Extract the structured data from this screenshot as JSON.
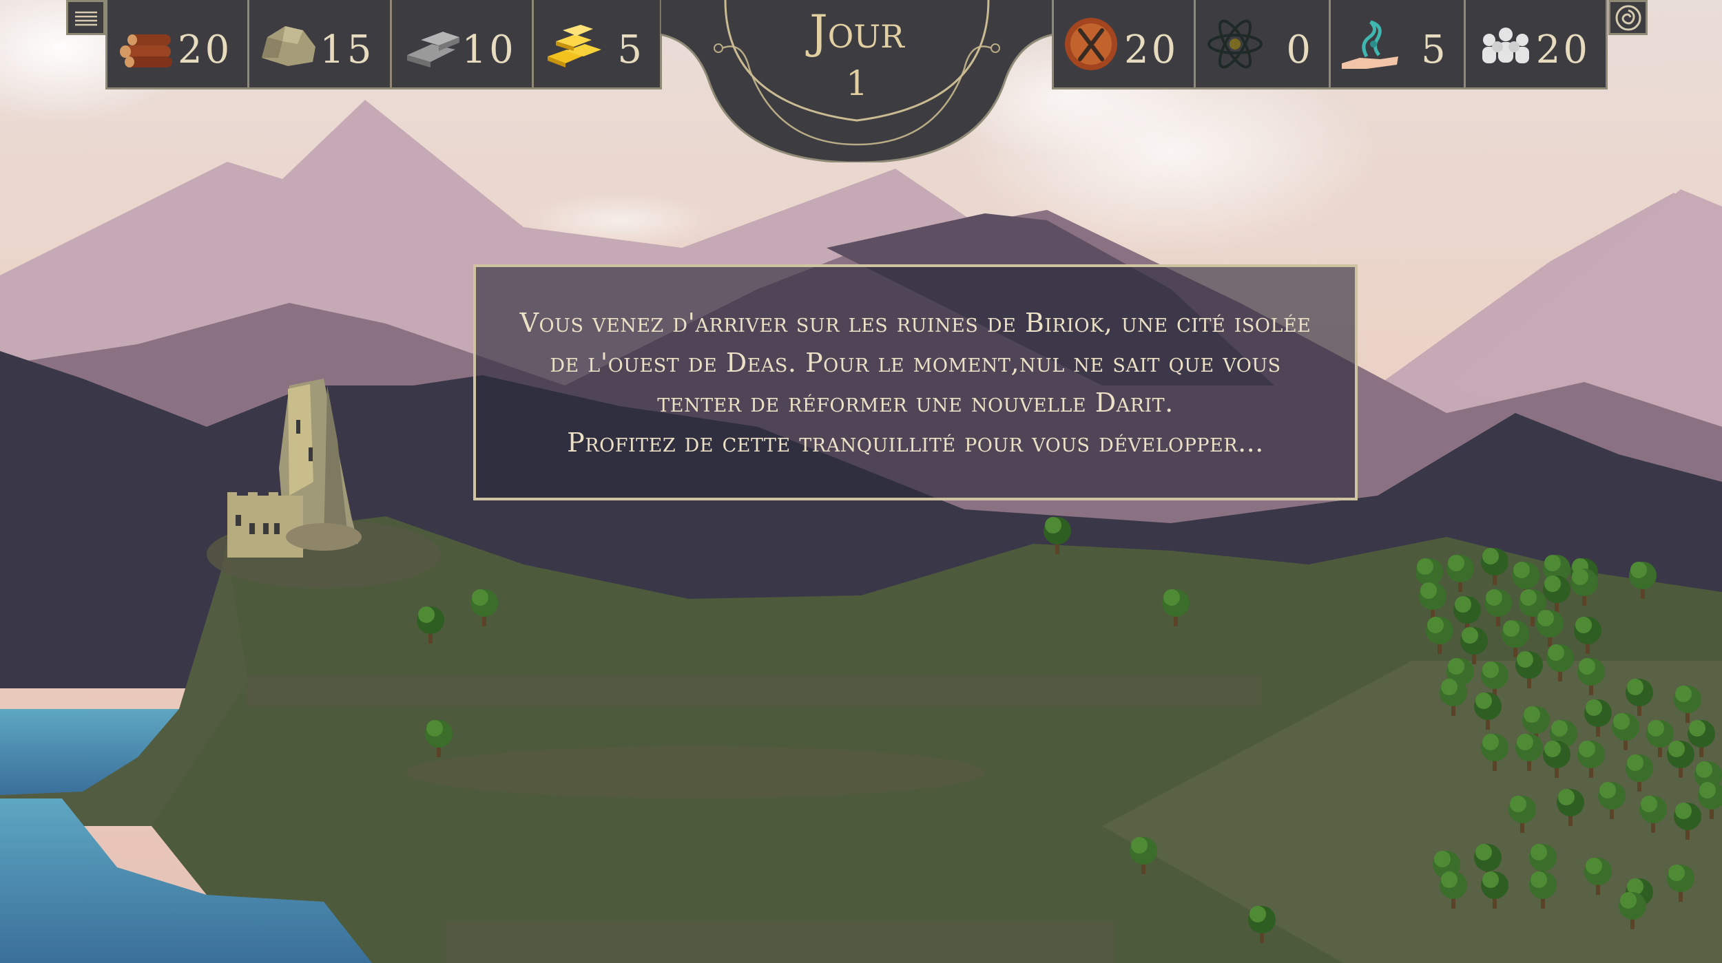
{
  "hud": {
    "resources_left": [
      {
        "name": "wood",
        "icon": "log-pile-icon",
        "value": "20"
      },
      {
        "name": "stone",
        "icon": "rock-icon",
        "value": "15"
      },
      {
        "name": "iron",
        "icon": "iron-ingot-icon",
        "value": "10"
      },
      {
        "name": "gold",
        "icon": "gold-bars-icon",
        "value": "5"
      }
    ],
    "resources_right": [
      {
        "name": "food",
        "icon": "fork-knife-icon",
        "value": "20"
      },
      {
        "name": "science",
        "icon": "atom-icon",
        "value": "0"
      },
      {
        "name": "magic",
        "icon": "magic-hand-icon",
        "value": "5"
      },
      {
        "name": "population",
        "icon": "population-icon",
        "value": "20"
      }
    ],
    "day_title": "Jour",
    "day_number": "1",
    "menu_icon": "hamburger-menu-icon",
    "settings_icon": "settings-swirl-icon"
  },
  "message": {
    "lines": [
      "Vous venez d'arriver sur les ruines de Biriok, une cité isolée",
      "de l'ouest de Deas. Pour le moment,nul ne sait que vous",
      "tenter de réformer une nouvelle Darit.",
      "Profitez de cette tranquillité pour vous développer..."
    ]
  },
  "colors": {
    "hud_bg": "#3d3d41",
    "hud_border": "#8e8a76",
    "hud_text": "#e7dcc0",
    "sky": "#ecd3c6",
    "grass": "#4d5a3c",
    "water": "#4a8fb0"
  }
}
